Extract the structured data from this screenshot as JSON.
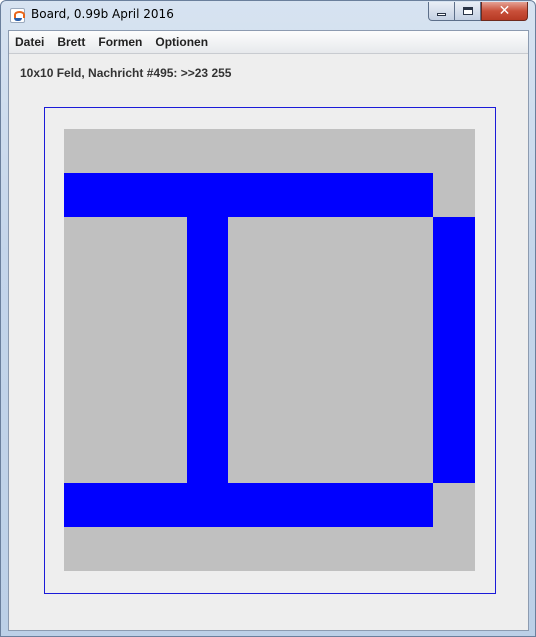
{
  "window": {
    "title": "Board, 0.99b April 2016",
    "icon": "java-icon",
    "controls": {
      "minimize": "minimize-icon",
      "maximize": "maximize-icon",
      "close": "close-icon",
      "close_glyph": "✕"
    }
  },
  "menu": {
    "items": [
      {
        "label": "Datei"
      },
      {
        "label": "Brett"
      },
      {
        "label": "Formen"
      },
      {
        "label": "Optionen"
      }
    ]
  },
  "status": {
    "message": "10x10 Feld, Nachricht #495: >>23 255"
  },
  "board": {
    "rows": 10,
    "cols": 10,
    "colors": {
      "empty": "#c0c0c0",
      "filled": "#0000ff",
      "frame": "#1a1ad8"
    },
    "filled_cells": [
      [
        1,
        0
      ],
      [
        1,
        1
      ],
      [
        1,
        2
      ],
      [
        1,
        3
      ],
      [
        1,
        4
      ],
      [
        1,
        5
      ],
      [
        1,
        6
      ],
      [
        1,
        7
      ],
      [
        1,
        8
      ],
      [
        2,
        3
      ],
      [
        3,
        3
      ],
      [
        4,
        3
      ],
      [
        5,
        3
      ],
      [
        6,
        3
      ],
      [
        7,
        3
      ],
      [
        8,
        0
      ],
      [
        8,
        1
      ],
      [
        8,
        2
      ],
      [
        8,
        3
      ],
      [
        8,
        4
      ],
      [
        8,
        5
      ],
      [
        8,
        6
      ],
      [
        8,
        7
      ],
      [
        8,
        8
      ],
      [
        2,
        9
      ],
      [
        3,
        9
      ],
      [
        4,
        9
      ],
      [
        5,
        9
      ],
      [
        6,
        9
      ],
      [
        7,
        9
      ]
    ]
  }
}
